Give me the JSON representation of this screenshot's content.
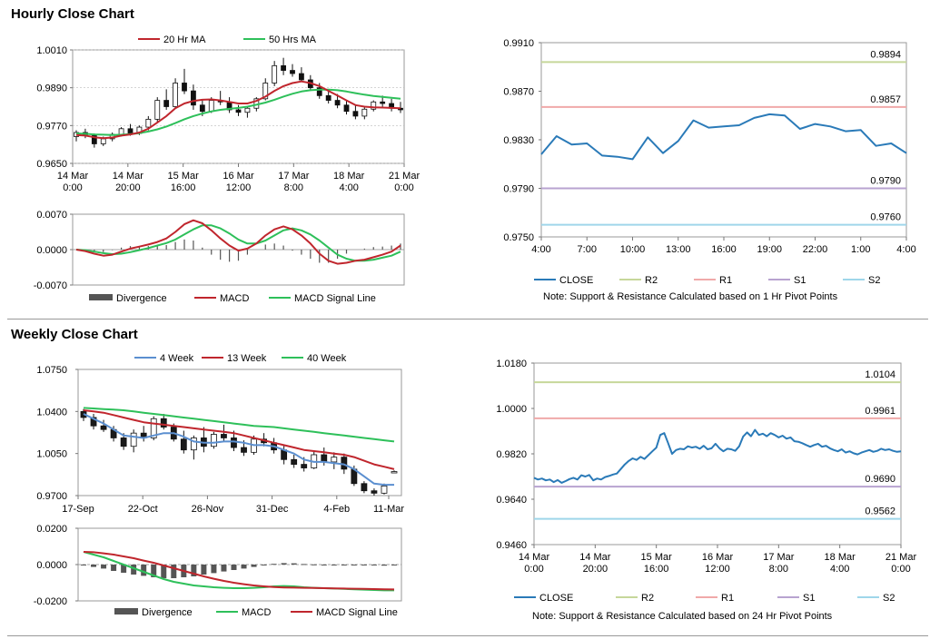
{
  "sections": {
    "hourly_title": "Hourly Close Chart",
    "weekly_title": "Weekly Close Chart"
  },
  "colors": {
    "ma20": "#c0262d",
    "ma50": "#2ec05a",
    "close": "#2a7ab8",
    "r2": "#c6d79a",
    "r1": "#f0a9a9",
    "s1": "#b8a3d0",
    "s2": "#9fd6ea",
    "divergence": "#555555",
    "candle_up": "#ffffff",
    "candle_down": "#1a1a1a",
    "wk4": "#5b8fd0",
    "wk13": "#c0262d",
    "wk40": "#2ec05a"
  },
  "chart_data": [
    {
      "id": "hourly-price",
      "type": "line",
      "legend": [
        "20 Hr MA",
        "50 Hrs MA"
      ],
      "yticks": [
        "1.0010",
        "0.9890",
        "0.9770",
        "0.9650"
      ],
      "ylim": [
        0.965,
        1.001
      ],
      "xticks": [
        [
          "14 Mar",
          "0:00"
        ],
        [
          "14 Mar",
          "20:00"
        ],
        [
          "15 Mar",
          "16:00"
        ],
        [
          "16 Mar",
          "12:00"
        ],
        [
          "17 Mar",
          "8:00"
        ],
        [
          "18 Mar",
          "4:00"
        ],
        [
          "21 Mar",
          "0:00"
        ]
      ],
      "candles": [
        [
          0.9735,
          0.9755,
          0.972,
          0.9748
        ],
        [
          0.9748,
          0.976,
          0.973,
          0.9738
        ],
        [
          0.9738,
          0.9745,
          0.97,
          0.9712
        ],
        [
          0.9712,
          0.9735,
          0.9705,
          0.9728
        ],
        [
          0.9728,
          0.9748,
          0.972,
          0.9742
        ],
        [
          0.9742,
          0.9765,
          0.9735,
          0.976
        ],
        [
          0.976,
          0.9775,
          0.9738,
          0.9745
        ],
        [
          0.9745,
          0.977,
          0.974,
          0.9765
        ],
        [
          0.9765,
          0.98,
          0.9755,
          0.979
        ],
        [
          0.979,
          0.986,
          0.978,
          0.985
        ],
        [
          0.985,
          0.9885,
          0.982,
          0.983
        ],
        [
          0.983,
          0.992,
          0.9825,
          0.9905
        ],
        [
          0.9905,
          0.995,
          0.987,
          0.988
        ],
        [
          0.988,
          0.99,
          0.982,
          0.9835
        ],
        [
          0.9835,
          0.985,
          0.98,
          0.9815
        ],
        [
          0.9815,
          0.986,
          0.981,
          0.985
        ],
        [
          0.985,
          0.988,
          0.9835,
          0.9845
        ],
        [
          0.9845,
          0.986,
          0.981,
          0.982
        ],
        [
          0.982,
          0.9835,
          0.98,
          0.9812
        ],
        [
          0.9812,
          0.983,
          0.9795,
          0.9825
        ],
        [
          0.9825,
          0.986,
          0.9815,
          0.9855
        ],
        [
          0.9855,
          0.992,
          0.985,
          0.9905
        ],
        [
          0.9905,
          0.9975,
          0.9895,
          0.996
        ],
        [
          0.996,
          0.9985,
          0.993,
          0.9945
        ],
        [
          0.9945,
          0.9965,
          0.9925,
          0.9935
        ],
        [
          0.9935,
          0.9955,
          0.991,
          0.9915
        ],
        [
          0.9915,
          0.993,
          0.988,
          0.989
        ],
        [
          0.989,
          0.9905,
          0.9855,
          0.9865
        ],
        [
          0.9865,
          0.9885,
          0.984,
          0.985
        ],
        [
          0.985,
          0.987,
          0.9825,
          0.9835
        ],
        [
          0.9835,
          0.985,
          0.9805,
          0.9815
        ],
        [
          0.9815,
          0.9835,
          0.979,
          0.98
        ],
        [
          0.98,
          0.983,
          0.979,
          0.9822
        ],
        [
          0.9822,
          0.985,
          0.9815,
          0.9845
        ],
        [
          0.9845,
          0.9865,
          0.983,
          0.984
        ],
        [
          0.984,
          0.9855,
          0.9815,
          0.9825
        ],
        [
          0.9825,
          0.9845,
          0.981,
          0.982
        ]
      ],
      "ma20": [
        0.974,
        0.9738,
        0.9733,
        0.973,
        0.9732,
        0.9738,
        0.9742,
        0.9748,
        0.976,
        0.978,
        0.98,
        0.9825,
        0.984,
        0.9848,
        0.9852,
        0.9853,
        0.985,
        0.9845,
        0.984,
        0.984,
        0.9848,
        0.9862,
        0.988,
        0.9895,
        0.9905,
        0.991,
        0.9905,
        0.9895,
        0.988,
        0.9865,
        0.985,
        0.9835,
        0.983,
        0.9828,
        0.9827,
        0.9826,
        0.9825
      ],
      "ma50": [
        0.9745,
        0.9744,
        0.9742,
        0.9741,
        0.974,
        0.9741,
        0.9743,
        0.9746,
        0.9751,
        0.9758,
        0.9767,
        0.9778,
        0.979,
        0.98,
        0.9808,
        0.9815,
        0.982,
        0.9823,
        0.9826,
        0.983,
        0.9836,
        0.9843,
        0.9852,
        0.9862,
        0.9871,
        0.9878,
        0.9882,
        0.9884,
        0.9884,
        0.9882,
        0.9878,
        0.9873,
        0.9868,
        0.9864,
        0.9861,
        0.9858,
        0.9855
      ]
    },
    {
      "id": "hourly-macd",
      "type": "line",
      "legend": [
        "Divergence",
        "MACD",
        "MACD  Signal Line"
      ],
      "yticks": [
        "0.0070",
        "0.0000",
        "-0.0070"
      ],
      "ylim": [
        -0.007,
        0.007
      ],
      "macd": [
        0.0,
        -0.0003,
        -0.0008,
        -0.0012,
        -0.001,
        -0.0004,
        0.0002,
        0.0006,
        0.001,
        0.0015,
        0.0022,
        0.0035,
        0.005,
        0.0058,
        0.0052,
        0.0038,
        0.0022,
        0.0008,
        -0.0002,
        0.0002,
        0.0012,
        0.0028,
        0.004,
        0.0046,
        0.004,
        0.0028,
        0.0012,
        -0.0008,
        -0.0022,
        -0.0028,
        -0.0026,
        -0.0022,
        -0.002,
        -0.0015,
        -0.001,
        -0.0004,
        0.0008
      ],
      "signal": [
        0.0,
        -0.0001,
        -0.0004,
        -0.0007,
        -0.0009,
        -0.0008,
        -0.0005,
        -0.0001,
        0.0003,
        0.0008,
        0.0013,
        0.002,
        0.003,
        0.004,
        0.0048,
        0.0048,
        0.0042,
        0.0032,
        0.002,
        0.0012,
        0.0012,
        0.0018,
        0.0028,
        0.0038,
        0.0042,
        0.0038,
        0.003,
        0.0018,
        0.0004,
        -0.001,
        -0.0018,
        -0.0022,
        -0.0022,
        -0.002,
        -0.0016,
        -0.0012,
        -0.0004
      ],
      "divergence": [
        0.0,
        -0.0002,
        -0.0004,
        -0.0005,
        -0.0001,
        0.0004,
        0.0007,
        0.0007,
        0.0007,
        0.0007,
        0.0009,
        0.0015,
        0.002,
        0.0018,
        0.0004,
        -0.001,
        -0.002,
        -0.0024,
        -0.0022,
        -0.001,
        0.0,
        0.001,
        0.0012,
        0.0008,
        -0.0002,
        -0.001,
        -0.0018,
        -0.0026,
        -0.0026,
        -0.0018,
        -0.0008,
        0.0,
        0.0002,
        0.0005,
        0.0006,
        0.0008,
        0.0012
      ]
    },
    {
      "id": "hourly-pivot",
      "type": "line",
      "yticks": [
        "0.9910",
        "0.9870",
        "0.9830",
        "0.9790",
        "0.9750"
      ],
      "ylim": [
        0.975,
        0.991
      ],
      "xticks": [
        "4:00",
        "7:00",
        "10:00",
        "13:00",
        "16:00",
        "19:00",
        "22:00",
        "1:00",
        "4:00"
      ],
      "close": [
        0.9818,
        0.9833,
        0.9826,
        0.9827,
        0.9817,
        0.9816,
        0.9814,
        0.9832,
        0.9819,
        0.9829,
        0.9846,
        0.984,
        0.9841,
        0.9842,
        0.9848,
        0.9851,
        0.985,
        0.9839,
        0.9843,
        0.9841,
        0.9837,
        0.9838,
        0.9825,
        0.9827,
        0.9819
      ],
      "levels": [
        {
          "name": "R2",
          "value": 0.9894,
          "label": "0.9894"
        },
        {
          "name": "R1",
          "value": 0.9857,
          "label": "0.9857"
        },
        {
          "name": "S1",
          "value": 0.979,
          "label": "0.9790"
        },
        {
          "name": "S2",
          "value": 0.976,
          "label": "0.9760"
        }
      ],
      "legend": [
        "CLOSE",
        "R2",
        "R1",
        "S1",
        "S2"
      ],
      "note": "Note: Support & Resistance Calculated based on 1 Hr Pivot Points"
    },
    {
      "id": "weekly-price",
      "type": "line",
      "legend": [
        "4 Week",
        "13 Week",
        "40 Week"
      ],
      "yticks": [
        "1.0750",
        "1.0400",
        "1.0050",
        "0.9700"
      ],
      "ylim": [
        0.97,
        1.075
      ],
      "xticks": [
        "17-Sep",
        "22-Oct",
        "26-Nov",
        "31-Dec",
        "4-Feb",
        "11-Mar"
      ],
      "candles": [
        [
          1.04,
          1.042,
          1.032,
          1.035
        ],
        [
          1.035,
          1.038,
          1.025,
          1.028
        ],
        [
          1.028,
          1.033,
          1.023,
          1.025
        ],
        [
          1.025,
          1.028,
          1.015,
          1.018
        ],
        [
          1.018,
          1.022,
          1.008,
          1.011
        ],
        [
          1.011,
          1.025,
          1.006,
          1.022
        ],
        [
          1.022,
          1.028,
          1.015,
          1.018
        ],
        [
          1.018,
          1.036,
          1.016,
          1.034
        ],
        [
          1.034,
          1.038,
          1.025,
          1.027
        ],
        [
          1.027,
          1.03,
          1.015,
          1.017
        ],
        [
          1.017,
          1.024,
          1.005,
          1.008
        ],
        [
          1.008,
          1.02,
          1.0,
          1.018
        ],
        [
          1.018,
          1.027,
          1.006,
          1.011
        ],
        [
          1.011,
          1.023,
          1.009,
          1.021
        ],
        [
          1.021,
          1.029,
          1.015,
          1.018
        ],
        [
          1.018,
          1.024,
          1.007,
          1.01
        ],
        [
          1.01,
          1.016,
          1.003,
          1.006
        ],
        [
          1.006,
          1.02,
          1.004,
          1.017
        ],
        [
          1.017,
          1.022,
          1.011,
          1.014
        ],
        [
          1.014,
          1.018,
          1.005,
          1.008
        ],
        [
          1.008,
          1.012,
          0.996,
          1.0
        ],
        [
          1.0,
          1.004,
          0.993,
          0.996
        ],
        [
          0.996,
          1.002,
          0.99,
          0.993
        ],
        [
          0.993,
          1.007,
          0.992,
          1.004
        ],
        [
          1.004,
          1.01,
          0.995,
          0.998
        ],
        [
          0.998,
          1.006,
          0.992,
          1.002
        ],
        [
          1.002,
          1.005,
          0.988,
          0.992
        ],
        [
          0.992,
          0.995,
          0.978,
          0.98
        ],
        [
          0.98,
          0.982,
          0.972,
          0.974
        ],
        [
          0.974,
          0.976,
          0.97,
          0.972
        ],
        [
          0.972,
          0.98,
          0.971,
          0.978
        ],
        [
          0.99,
          0.991,
          0.989,
          0.99
        ]
      ],
      "wk4": [
        1.038,
        1.034,
        1.03,
        1.025,
        1.02,
        1.019,
        1.018,
        1.02,
        1.022,
        1.022,
        1.019,
        1.015,
        1.014,
        1.014,
        1.015,
        1.015,
        1.014,
        1.012,
        1.012,
        1.011,
        1.008,
        1.005,
        1.0,
        0.998,
        0.998,
        0.997,
        0.996,
        0.992,
        0.986,
        0.98,
        0.979,
        0.979
      ],
      "wk13": [
        1.041,
        1.04,
        1.039,
        1.037,
        1.035,
        1.033,
        1.031,
        1.03,
        1.029,
        1.028,
        1.027,
        1.026,
        1.025,
        1.024,
        1.023,
        1.022,
        1.02,
        1.018,
        1.016,
        1.014,
        1.012,
        1.01,
        1.008,
        1.007,
        1.006,
        1.005,
        1.004,
        1.002,
        0.999,
        0.996,
        0.994,
        0.992
      ],
      "wk40": [
        1.043,
        1.0425,
        1.042,
        1.0415,
        1.041,
        1.04,
        1.039,
        1.038,
        1.037,
        1.036,
        1.035,
        1.034,
        1.033,
        1.032,
        1.031,
        1.03,
        1.029,
        1.028,
        1.0275,
        1.027,
        1.026,
        1.025,
        1.024,
        1.023,
        1.022,
        1.021,
        1.02,
        1.019,
        1.018,
        1.017,
        1.016,
        1.015
      ]
    },
    {
      "id": "weekly-macd",
      "type": "line",
      "legend": [
        "Divergence",
        "MACD",
        "MACD  Signal Line"
      ],
      "yticks": [
        "0.0200",
        "0.0000",
        "-0.0200"
      ],
      "ylim": [
        -0.02,
        0.02
      ],
      "macd": [
        0.007,
        0.0055,
        0.004,
        0.002,
        0.0,
        -0.002,
        -0.004,
        -0.006,
        -0.008,
        -0.0095,
        -0.0105,
        -0.0115,
        -0.012,
        -0.0125,
        -0.0128,
        -0.013,
        -0.013,
        -0.0128,
        -0.0125,
        -0.012,
        -0.0118,
        -0.012,
        -0.0125,
        -0.0128,
        -0.013,
        -0.0132,
        -0.0134,
        -0.0136,
        -0.0138,
        -0.014,
        -0.0142,
        -0.0142
      ],
      "signal": [
        0.007,
        0.0068,
        0.0062,
        0.0055,
        0.0045,
        0.0035,
        0.0022,
        0.001,
        -0.0005,
        -0.002,
        -0.0035,
        -0.005,
        -0.0065,
        -0.0078,
        -0.009,
        -0.01,
        -0.0108,
        -0.0115,
        -0.012,
        -0.0124,
        -0.0126,
        -0.0127,
        -0.0128,
        -0.0129,
        -0.013,
        -0.0131,
        -0.0132,
        -0.0133,
        -0.0134,
        -0.0135,
        -0.0136,
        -0.0137
      ],
      "divergence": [
        0.0,
        -0.0013,
        -0.0022,
        -0.0035,
        -0.0045,
        -0.0055,
        -0.0062,
        -0.007,
        -0.0075,
        -0.0075,
        -0.007,
        -0.0065,
        -0.0055,
        -0.0047,
        -0.0038,
        -0.003,
        -0.0022,
        -0.0013,
        -0.0005,
        0.0004,
        0.0008,
        0.0007,
        0.0003,
        0.0001,
        0.0,
        -0.0001,
        -0.0002,
        -0.0003,
        -0.0004,
        -0.0005,
        -0.0006,
        -0.0005
      ]
    },
    {
      "id": "weekly-pivot",
      "type": "line",
      "yticks": [
        "1.0180",
        "1.0000",
        "0.9820",
        "0.9640",
        "0.9460"
      ],
      "ylim": [
        0.946,
        1.018
      ],
      "xticks": [
        [
          "14 Mar",
          "0:00"
        ],
        [
          "14 Mar",
          "20:00"
        ],
        [
          "15 Mar",
          "16:00"
        ],
        [
          "16 Mar",
          "12:00"
        ],
        [
          "17 Mar",
          "8:00"
        ],
        [
          "18 Mar",
          "4:00"
        ],
        [
          "21 Mar",
          "0:00"
        ]
      ],
      "close": [
        0.9725,
        0.9718,
        0.9722,
        0.9715,
        0.9718,
        0.9708,
        0.9716,
        0.9705,
        0.9712,
        0.972,
        0.9725,
        0.9718,
        0.9735,
        0.973,
        0.9736,
        0.9715,
        0.9722,
        0.9718,
        0.9728,
        0.9732,
        0.9738,
        0.9742,
        0.976,
        0.9778,
        0.9792,
        0.9802,
        0.9796,
        0.9808,
        0.98,
        0.9815,
        0.983,
        0.9845,
        0.9895,
        0.9902,
        0.9862,
        0.982,
        0.9835,
        0.984,
        0.9838,
        0.985,
        0.9845,
        0.9848,
        0.984,
        0.9852,
        0.9838,
        0.9842,
        0.986,
        0.9842,
        0.983,
        0.984,
        0.9838,
        0.9832,
        0.985,
        0.9888,
        0.9905,
        0.989,
        0.9915,
        0.9895,
        0.99,
        0.989,
        0.9902,
        0.9895,
        0.9885,
        0.9892,
        0.988,
        0.9885,
        0.987,
        0.9868,
        0.9862,
        0.9855,
        0.9848,
        0.9855,
        0.986,
        0.9848,
        0.9852,
        0.9842,
        0.9835,
        0.983,
        0.9838,
        0.9825,
        0.983,
        0.9822,
        0.9818,
        0.9825,
        0.983,
        0.9835,
        0.9828,
        0.9832,
        0.984,
        0.9835,
        0.9838,
        0.9832,
        0.9828,
        0.983
      ],
      "levels": [
        {
          "name": "R2",
          "value": 1.0104,
          "label": "1.0104"
        },
        {
          "name": "R1",
          "value": 0.9961,
          "label": "0.9961"
        },
        {
          "name": "S1",
          "value": 0.969,
          "label": "0.9690"
        },
        {
          "name": "S2",
          "value": 0.9562,
          "label": "0.9562"
        }
      ],
      "legend": [
        "CLOSE",
        "R2",
        "R1",
        "S1",
        "S2"
      ],
      "note": "Note: Support & Resistance Calculated based on 24 Hr Pivot Points"
    }
  ]
}
